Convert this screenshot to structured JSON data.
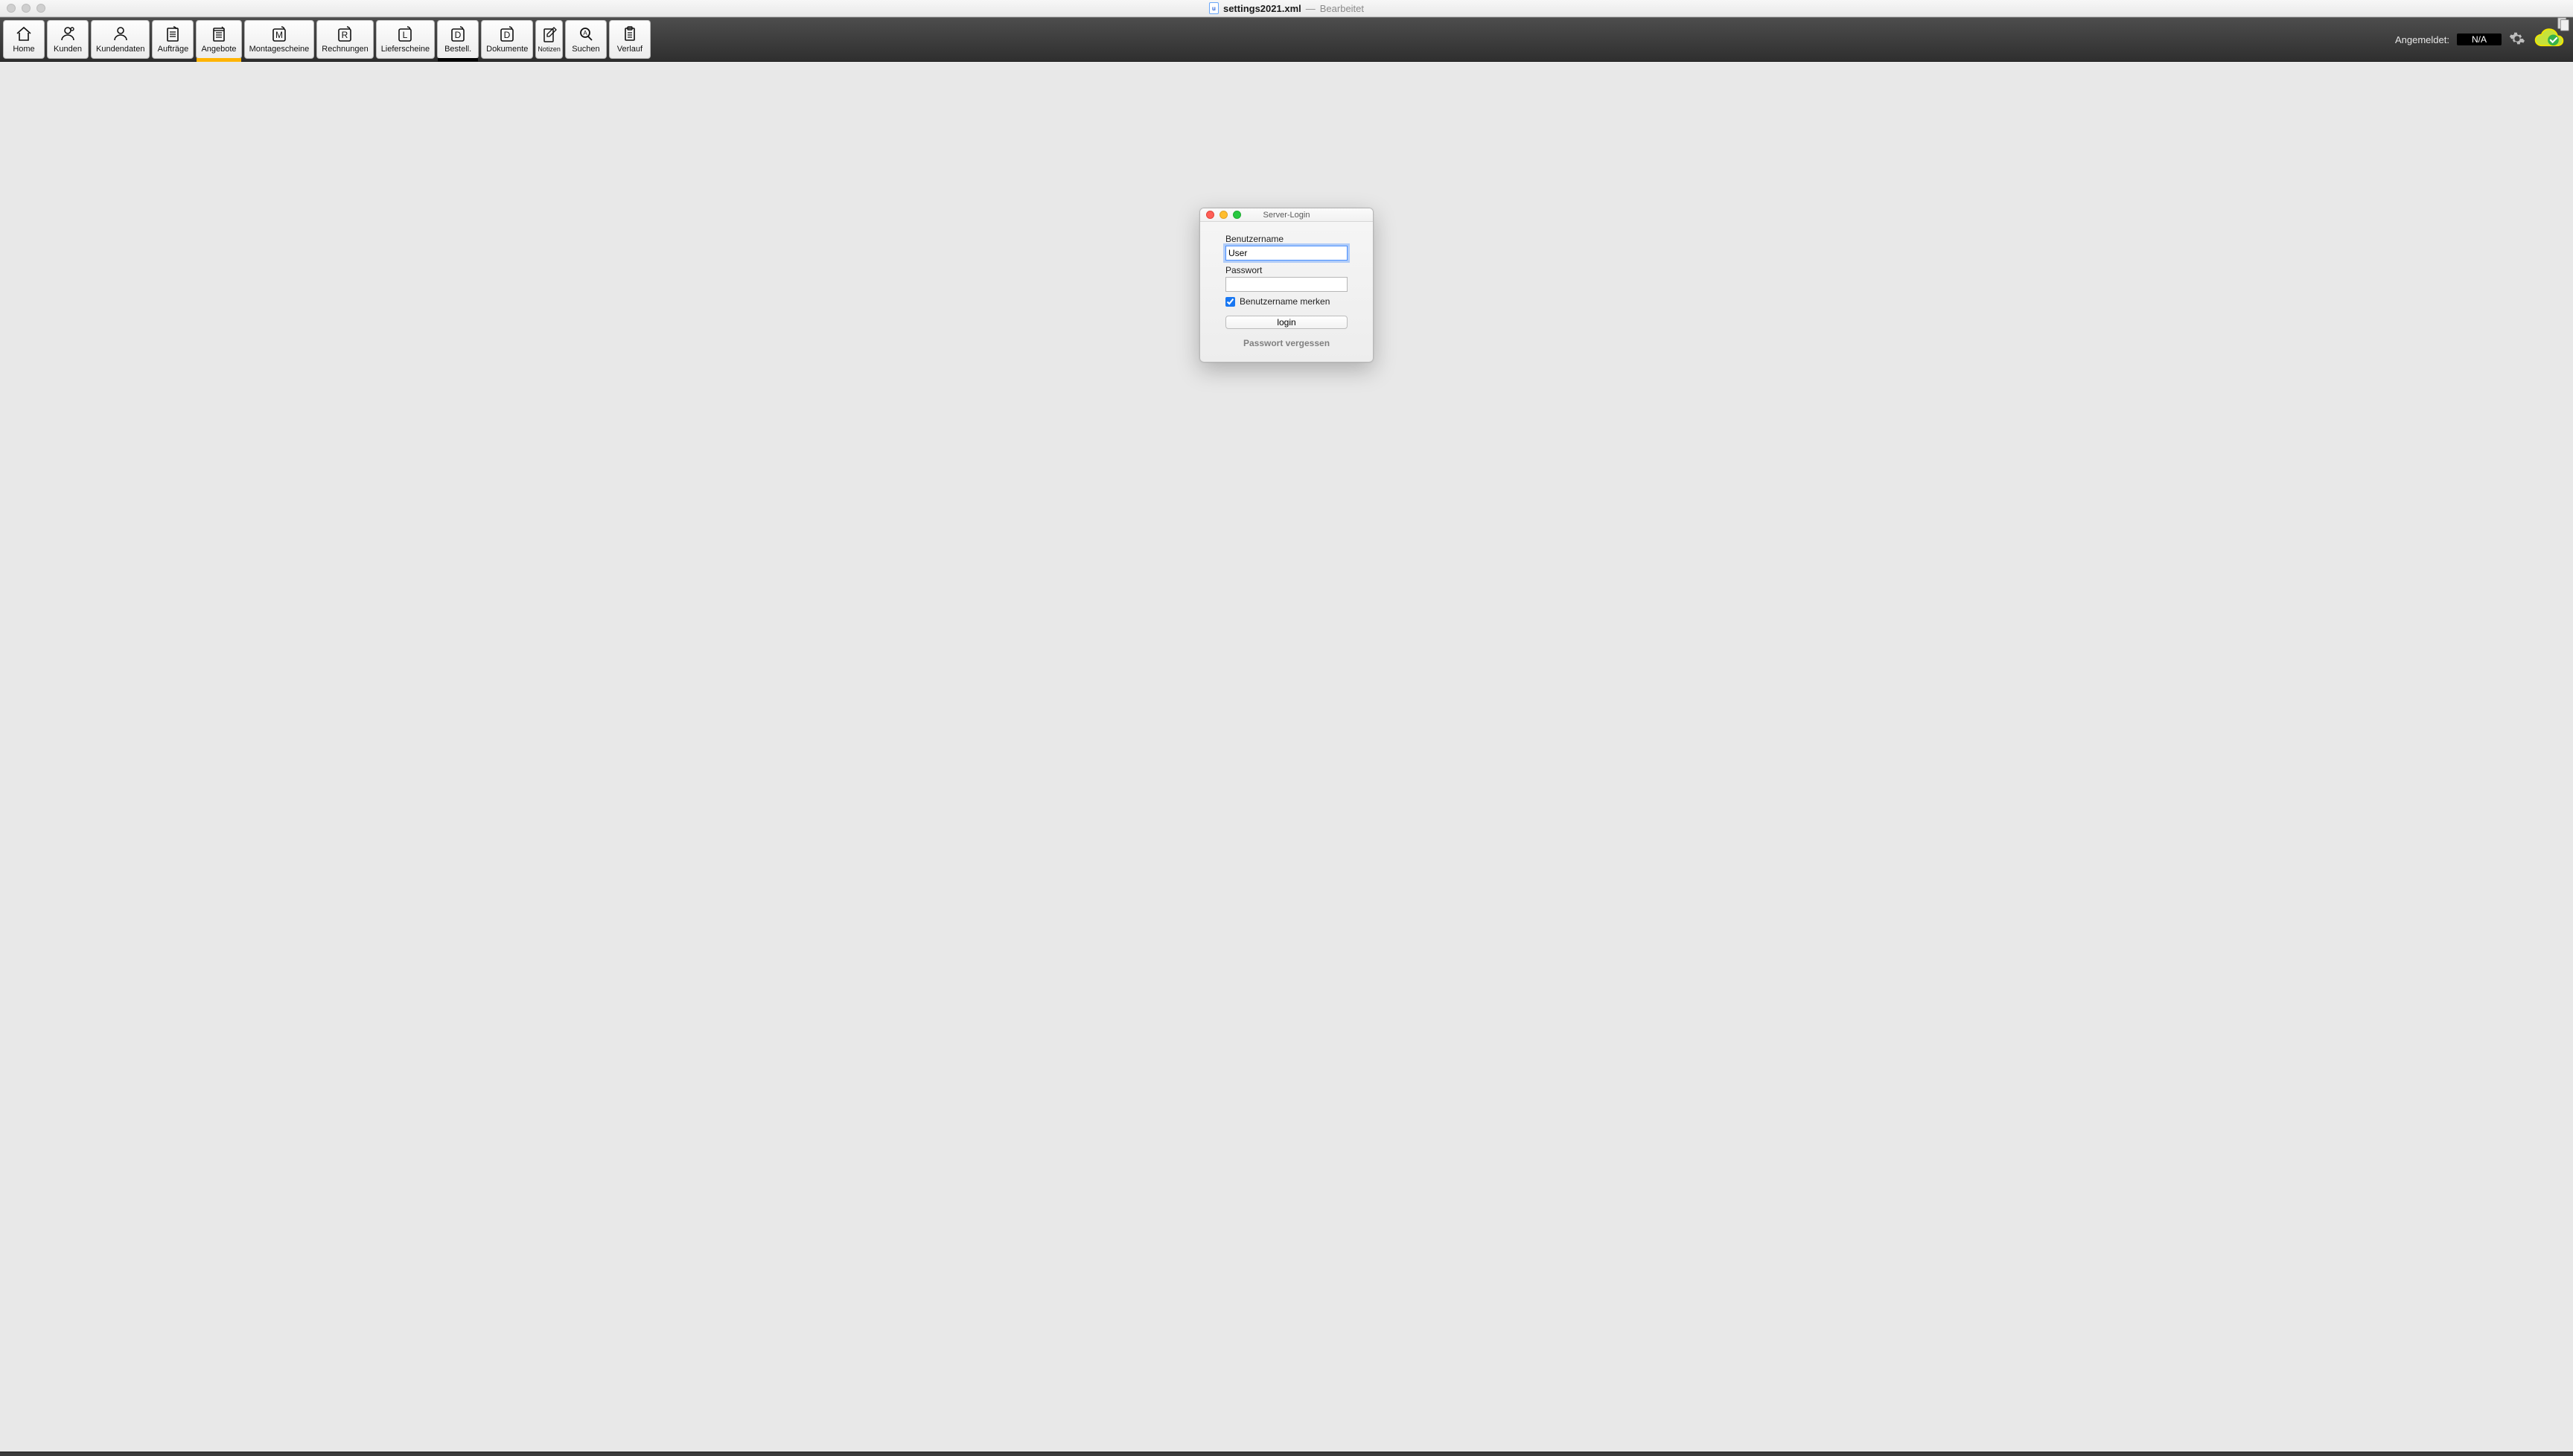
{
  "titlebar": {
    "filename": "settings2021.xml",
    "separator": "—",
    "status": "Bearbeitet"
  },
  "toolbar": {
    "items": [
      {
        "id": "home",
        "label": "Home"
      },
      {
        "id": "kunden",
        "label": "Kunden"
      },
      {
        "id": "kundendaten",
        "label": "Kundendaten"
      },
      {
        "id": "auftraege",
        "label": "Aufträge"
      },
      {
        "id": "angebote",
        "label": "Angebote",
        "underline": "orange"
      },
      {
        "id": "montage",
        "label": "Montagescheine"
      },
      {
        "id": "rechnungen",
        "label": "Rechnungen"
      },
      {
        "id": "liefer",
        "label": "Lieferscheine"
      },
      {
        "id": "bestell",
        "label": "Bestell.",
        "underline": "black"
      },
      {
        "id": "dokumente",
        "label": "Dokumente"
      },
      {
        "id": "notizen",
        "label": "Notizen",
        "narrow": true
      },
      {
        "id": "suchen",
        "label": "Suchen"
      },
      {
        "id": "verlauf",
        "label": "Verlauf"
      }
    ],
    "logged_label": "Angemeldet:",
    "logged_value": "N/A"
  },
  "login": {
    "window_title": "Server-Login",
    "username_label": "Benutzername",
    "username_value": "User",
    "password_label": "Passwort",
    "password_value": "",
    "remember_label": "Benutzername merken",
    "remember_checked": true,
    "login_button": "login",
    "forgot": "Passwort vergessen"
  }
}
